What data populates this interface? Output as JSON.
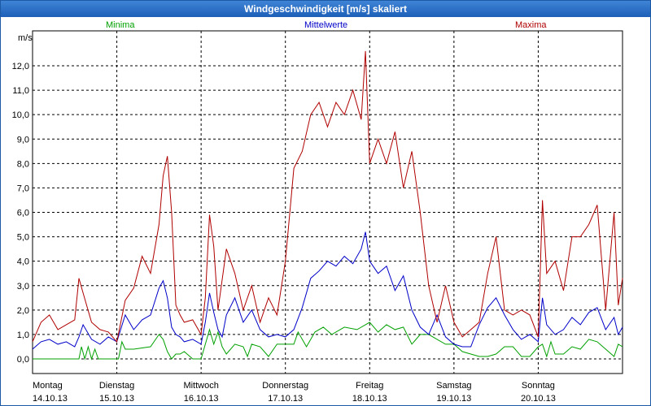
{
  "window": {
    "title": "Windgeschwindigkeit [m/s] skaliert"
  },
  "chart_data": {
    "type": "line",
    "title": "Windgeschwindigkeit [m/s] skaliert",
    "ylabel": "m/s",
    "ylim": [
      -0.5,
      13.0
    ],
    "xlim": [
      0,
      7
    ],
    "grid": true,
    "legend_placement": "top",
    "yticks": [
      0,
      1,
      2,
      3,
      4,
      5,
      6,
      7,
      8,
      9,
      10,
      11,
      12
    ],
    "ytick_labels": [
      "0,0",
      "1,0",
      "2,0",
      "3,0",
      "4,0",
      "5,0",
      "6,0",
      "7,0",
      "8,0",
      "9,0",
      "10,0",
      "11,0",
      "12,0"
    ],
    "xticks": [
      {
        "x": 0,
        "day": "Montag",
        "date": "14.10.13"
      },
      {
        "x": 1,
        "day": "Dienstag",
        "date": "15.10.13"
      },
      {
        "x": 2,
        "day": "Mittwoch",
        "date": "16.10.13"
      },
      {
        "x": 3,
        "day": "Donnerstag",
        "date": "17.10.13"
      },
      {
        "x": 4,
        "day": "Freitag",
        "date": "18.10.13"
      },
      {
        "x": 5,
        "day": "Samstag",
        "date": "19.10.13"
      },
      {
        "x": 6,
        "day": "Sonntag",
        "date": "20.10.13"
      }
    ],
    "series": [
      {
        "name": "Minima",
        "color": "#00a000",
        "x": [
          0,
          0.55,
          0.58,
          0.62,
          0.66,
          0.7,
          0.74,
          0.78,
          0.95,
          1.02,
          1.06,
          1.1,
          1.2,
          1.4,
          1.5,
          1.55,
          1.6,
          1.65,
          1.7,
          1.75,
          1.8,
          1.9,
          2.0,
          2.1,
          2.15,
          2.2,
          2.25,
          2.3,
          2.4,
          2.5,
          2.55,
          2.6,
          2.7,
          2.8,
          2.9,
          3.0,
          3.1,
          3.15,
          3.25,
          3.35,
          3.45,
          3.55,
          3.7,
          3.85,
          4.0,
          4.1,
          4.2,
          4.3,
          4.4,
          4.5,
          4.6,
          4.7,
          4.8,
          4.9,
          5.0,
          5.1,
          5.3,
          5.4,
          5.5,
          5.6,
          5.7,
          5.8,
          5.9,
          6.0,
          6.05,
          6.1,
          6.15,
          6.2,
          6.3,
          6.4,
          6.5,
          6.6,
          6.7,
          6.8,
          6.9,
          6.95,
          7.0
        ],
        "values": [
          0,
          0,
          0.5,
          0,
          0.5,
          0,
          0.4,
          0,
          0,
          0,
          0.7,
          0.4,
          0.4,
          0.5,
          1.0,
          0.8,
          0.3,
          0,
          0.2,
          0.2,
          0.3,
          0,
          0,
          1.2,
          0.6,
          1.1,
          0.5,
          0.2,
          0.6,
          0.5,
          0.1,
          0.6,
          0.5,
          0.1,
          0.6,
          0.6,
          0.6,
          1.1,
          0.5,
          1.1,
          1.3,
          1.0,
          1.3,
          1.2,
          1.5,
          1.1,
          1.4,
          1.2,
          1.3,
          0.6,
          1.0,
          1.0,
          0.8,
          0.6,
          0.6,
          0.3,
          0.1,
          0.1,
          0.2,
          0.5,
          0.5,
          0.1,
          0.1,
          0.5,
          0.6,
          0.1,
          0.7,
          0.2,
          0.2,
          0.5,
          0.4,
          0.8,
          0.7,
          0.4,
          0.1,
          0.6,
          0.5
        ]
      },
      {
        "name": "Mittelwerte",
        "color": "#0000c8",
        "x": [
          0,
          0.1,
          0.2,
          0.3,
          0.4,
          0.5,
          0.55,
          0.6,
          0.7,
          0.8,
          0.9,
          1.0,
          1.1,
          1.2,
          1.3,
          1.4,
          1.5,
          1.55,
          1.6,
          1.65,
          1.7,
          1.75,
          1.8,
          1.9,
          2.0,
          2.05,
          2.1,
          2.15,
          2.2,
          2.25,
          2.3,
          2.4,
          2.5,
          2.6,
          2.7,
          2.8,
          2.9,
          3.0,
          3.1,
          3.2,
          3.3,
          3.4,
          3.5,
          3.6,
          3.7,
          3.8,
          3.9,
          3.95,
          4.0,
          4.1,
          4.2,
          4.3,
          4.4,
          4.5,
          4.6,
          4.7,
          4.8,
          4.9,
          5.0,
          5.1,
          5.2,
          5.3,
          5.4,
          5.5,
          5.6,
          5.7,
          5.8,
          5.9,
          6.0,
          6.05,
          6.1,
          6.2,
          6.3,
          6.4,
          6.5,
          6.6,
          6.7,
          6.8,
          6.9,
          6.95,
          7.0
        ],
        "values": [
          0.4,
          0.7,
          0.8,
          0.6,
          0.7,
          0.5,
          0.9,
          1.4,
          0.8,
          0.6,
          0.9,
          0.7,
          1.8,
          1.2,
          1.6,
          1.8,
          2.9,
          3.2,
          2.5,
          1.3,
          1.0,
          0.9,
          0.7,
          0.8,
          0.6,
          1.5,
          2.7,
          1.9,
          1.2,
          0.9,
          1.8,
          2.5,
          1.5,
          2.0,
          1.2,
          0.9,
          1.0,
          0.9,
          1.2,
          2.1,
          3.3,
          3.6,
          4.0,
          3.8,
          4.2,
          3.9,
          4.5,
          5.2,
          4.0,
          3.5,
          3.8,
          2.8,
          3.4,
          2.0,
          1.3,
          1.0,
          1.8,
          0.9,
          0.6,
          0.5,
          0.5,
          1.4,
          2.1,
          2.5,
          1.8,
          1.2,
          0.8,
          1.0,
          0.7,
          2.5,
          1.4,
          1.0,
          1.2,
          1.7,
          1.4,
          1.9,
          2.1,
          1.2,
          1.7,
          1.0,
          1.3
        ]
      },
      {
        "name": "Maxima",
        "color": "#b00000",
        "x": [
          0,
          0.1,
          0.2,
          0.3,
          0.4,
          0.5,
          0.55,
          0.6,
          0.7,
          0.8,
          0.9,
          1.0,
          1.1,
          1.2,
          1.3,
          1.4,
          1.5,
          1.55,
          1.6,
          1.65,
          1.7,
          1.75,
          1.8,
          1.9,
          2.0,
          2.05,
          2.1,
          2.15,
          2.2,
          2.3,
          2.4,
          2.5,
          2.6,
          2.7,
          2.8,
          2.9,
          3.0,
          3.1,
          3.2,
          3.3,
          3.4,
          3.5,
          3.6,
          3.7,
          3.8,
          3.9,
          3.95,
          4.0,
          4.1,
          4.2,
          4.3,
          4.4,
          4.5,
          4.6,
          4.7,
          4.8,
          4.9,
          5.0,
          5.1,
          5.2,
          5.3,
          5.4,
          5.5,
          5.6,
          5.7,
          5.8,
          5.9,
          6.0,
          6.05,
          6.1,
          6.2,
          6.3,
          6.4,
          6.5,
          6.6,
          6.7,
          6.8,
          6.9,
          6.95,
          7.0
        ],
        "values": [
          0.7,
          1.5,
          1.8,
          1.2,
          1.4,
          1.6,
          3.3,
          2.7,
          1.5,
          1.2,
          1.1,
          0.7,
          2.4,
          2.9,
          4.2,
          3.5,
          5.5,
          7.5,
          8.3,
          6.0,
          2.2,
          1.8,
          1.5,
          1.6,
          1.0,
          2.5,
          5.9,
          4.6,
          2.0,
          4.5,
          3.5,
          2.0,
          3.0,
          1.5,
          2.5,
          1.8,
          4.0,
          7.8,
          8.5,
          10.0,
          10.5,
          9.5,
          10.5,
          10.0,
          11.0,
          9.8,
          12.6,
          8.0,
          9.0,
          8.0,
          9.3,
          7.0,
          8.5,
          6.0,
          3.0,
          1.5,
          3.0,
          1.5,
          0.9,
          1.2,
          1.5,
          3.5,
          5.0,
          2.0,
          1.8,
          2.0,
          1.8,
          0.9,
          6.5,
          3.5,
          4.0,
          2.8,
          5.0,
          5.0,
          5.5,
          6.3,
          2.0,
          6.0,
          2.2,
          3.3
        ]
      }
    ]
  }
}
